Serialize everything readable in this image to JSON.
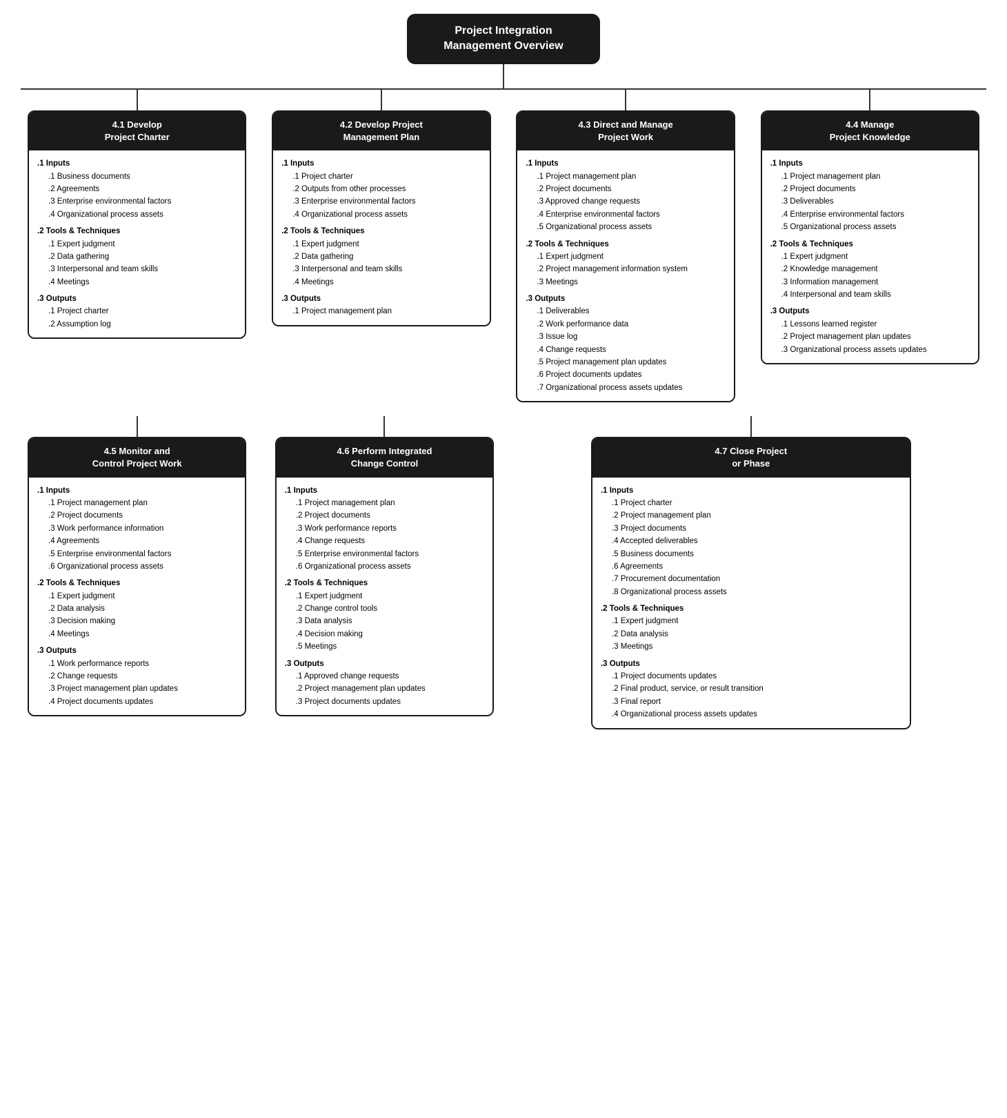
{
  "root": {
    "title": "Project Integration\nManagement Overview"
  },
  "processes": {
    "p41": {
      "header": "4.1 Develop\nProject Charter",
      "sections": [
        {
          "label": ".1 Inputs",
          "items": [
            ".1 Business documents",
            ".2 Agreements",
            ".3 Enterprise environmental\n    factors",
            ".4 Organizational process\n    assets"
          ]
        },
        {
          "label": ".2 Tools & Techniques",
          "items": [
            ".1 Expert judgment",
            ".2 Data gathering",
            ".3 Interpersonal and team\n    skills",
            ".4 Meetings"
          ]
        },
        {
          "label": ".3 Outputs",
          "items": [
            ".1 Project charter",
            ".2 Assumption log"
          ]
        }
      ]
    },
    "p42": {
      "header": "4.2 Develop Project\nManagement Plan",
      "sections": [
        {
          "label": ".1 Inputs",
          "items": [
            ".1 Project charter",
            ".2 Outputs from other\n    processes",
            ".3 Enterprise environmental\n    factors",
            ".4 Organizational process\n    assets"
          ]
        },
        {
          "label": ".2 Tools & Techniques",
          "items": [
            ".1 Expert judgment",
            ".2 Data gathering",
            ".3 Interpersonal and team\n    skills",
            ".4 Meetings"
          ]
        },
        {
          "label": ".3 Outputs",
          "items": [
            ".1 Project management plan"
          ]
        }
      ]
    },
    "p43": {
      "header": "4.3 Direct and Manage\nProject Work",
      "sections": [
        {
          "label": ".1 Inputs",
          "items": [
            ".1 Project management plan",
            ".2 Project documents",
            ".3 Approved change requests",
            ".4 Enterprise environmental\n    factors",
            ".5 Organizational process\n    assets"
          ]
        },
        {
          "label": ".2 Tools & Techniques",
          "items": [
            ".1 Expert judgment",
            ".2 Project management\n    information system",
            ".3 Meetings"
          ]
        },
        {
          "label": ".3 Outputs",
          "items": [
            ".1 Deliverables",
            ".2 Work performance data",
            ".3 Issue log",
            ".4 Change requests",
            ".5 Project management plan\n    updates",
            ".6 Project documents updates",
            ".7 Organizational process\n    assets updates"
          ]
        }
      ]
    },
    "p44": {
      "header": "4.4 Manage\nProject Knowledge",
      "sections": [
        {
          "label": ".1 Inputs",
          "items": [
            ".1 Project management plan",
            ".2 Project documents",
            ".3 Deliverables",
            ".4 Enterprise environmental\n    factors",
            ".5 Organizational process\n    assets"
          ]
        },
        {
          "label": ".2 Tools & Techniques",
          "items": [
            ".1 Expert judgment",
            ".2 Knowledge management",
            ".3 Information management",
            ".4 Interpersonal and team\n    skills"
          ]
        },
        {
          "label": ".3 Outputs",
          "items": [
            ".1 Lessons learned register",
            ".2 Project management plan\n    updates",
            ".3 Organizational process\n    assets updates"
          ]
        }
      ]
    },
    "p45": {
      "header": "4.5 Monitor and\nControl Project Work",
      "sections": [
        {
          "label": ".1 Inputs",
          "items": [
            ".1 Project management plan",
            ".2 Project documents",
            ".3 Work performance\n    information",
            ".4 Agreements",
            ".5 Enterprise environmental\n    factors",
            ".6 Organizational process\n    assets"
          ]
        },
        {
          "label": ".2 Tools & Techniques",
          "items": [
            ".1 Expert judgment",
            ".2 Data analysis",
            ".3 Decision making",
            ".4 Meetings"
          ]
        },
        {
          "label": ".3 Outputs",
          "items": [
            ".1 Work performance reports",
            ".2 Change requests",
            ".3 Project management plan\n    updates",
            ".4 Project documents updates"
          ]
        }
      ]
    },
    "p46": {
      "header": "4.6 Perform Integrated\nChange Control",
      "sections": [
        {
          "label": ".1 Inputs",
          "items": [
            ".1 Project management plan",
            ".2 Project documents",
            ".3 Work performance reports",
            ".4 Change requests",
            ".5 Enterprise environmental\n    factors",
            ".6 Organizational process\n    assets"
          ]
        },
        {
          "label": ".2 Tools & Techniques",
          "items": [
            ".1 Expert judgment",
            ".2 Change control tools",
            ".3 Data analysis",
            ".4 Decision making",
            ".5 Meetings"
          ]
        },
        {
          "label": ".3 Outputs",
          "items": [
            ".1 Approved change requests",
            ".2 Project management plan\n    updates",
            ".3 Project documents\n    updates"
          ]
        }
      ]
    },
    "p47": {
      "header": "4.7 Close Project\nor Phase",
      "sections": [
        {
          "label": ".1 Inputs",
          "items": [
            ".1 Project charter",
            ".2 Project management plan",
            ".3 Project documents",
            ".4 Accepted deliverables",
            ".5 Business documents",
            ".6 Agreements",
            ".7 Procurement\n    documentation",
            ".8 Organizational process\n    assets"
          ]
        },
        {
          "label": ".2 Tools & Techniques",
          "items": [
            ".1 Expert judgment",
            ".2 Data analysis",
            ".3 Meetings"
          ]
        },
        {
          "label": ".3 Outputs",
          "items": [
            ".1 Project documents updates",
            ".2 Final product, service, or\n    result transition",
            ".3 Final report",
            ".4 Organizational process\n    assets updates"
          ]
        }
      ]
    }
  }
}
